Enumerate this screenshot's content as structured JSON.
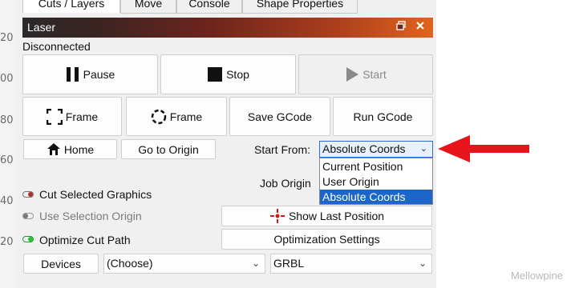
{
  "ruler": {
    "ticks": [
      "20",
      "00",
      "80",
      "60",
      "40",
      "20"
    ]
  },
  "tabs": [
    {
      "label": "Cuts / Layers",
      "active": true
    },
    {
      "label": "Move",
      "active": false
    },
    {
      "label": "Console",
      "active": false
    },
    {
      "label": "Shape Properties",
      "active": false
    }
  ],
  "panel": {
    "title": "Laser",
    "status": "Disconnected",
    "buttons": {
      "pause": "Pause",
      "stop": "Stop",
      "start": "Start",
      "frame_rect": "Frame",
      "frame_round": "Frame",
      "save_gcode": "Save GCode",
      "run_gcode": "Run GCode",
      "home": "Home",
      "go_to_origin": "Go to Origin",
      "show_last_position": "Show Last Position",
      "optimization_settings": "Optimization Settings",
      "devices": "Devices"
    },
    "start_from": {
      "label": "Start From:",
      "value": "Absolute Coords",
      "options": [
        "Current Position",
        "User Origin",
        "Absolute Coords"
      ]
    },
    "job_origin_label": "Job Origin",
    "toggles": [
      {
        "label": "Cut Selected Graphics",
        "enabled": true,
        "state": "off"
      },
      {
        "label": "Use Selection Origin",
        "enabled": false,
        "state": "off"
      },
      {
        "label": "Optimize Cut Path",
        "enabled": true,
        "state": "on"
      }
    ],
    "device_select": "(Choose)",
    "controller_select": "GRBL"
  },
  "colors": {
    "accent": "#1d66c9",
    "annotation_arrow": "#e8141b",
    "toggle_on": "#22c33a",
    "toggle_off": "#b03030"
  },
  "watermark": "Mellowpine"
}
